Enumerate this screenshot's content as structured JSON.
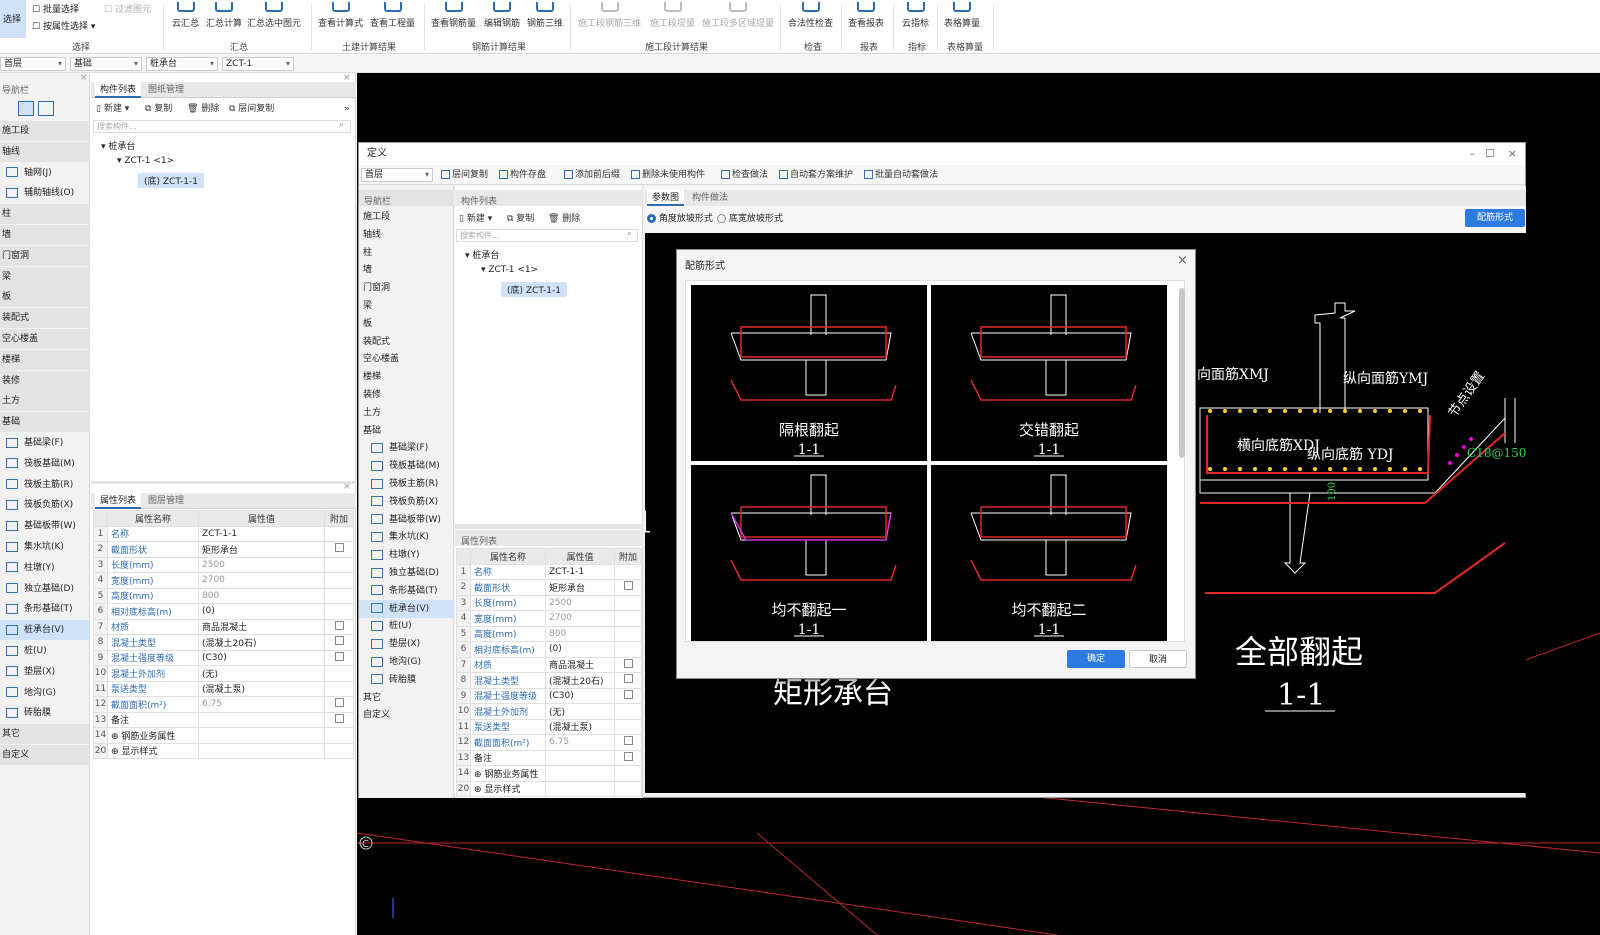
{
  "ribbon": {
    "select": "选择",
    "batch_select": "批量选择",
    "filter_draw": "过滤图元",
    "attr_select": "按属性选择",
    "g_select": "选择",
    "cloud_sum": "云汇总",
    "sum_calc": "汇总计算",
    "sum_sel": "汇总选中图元",
    "g_sum": "汇总",
    "view_formula": "查看计算式",
    "view_qty": "查看工程量",
    "g_civil": "土建计算结果",
    "view_rebar": "查看钢筋量",
    "edit_rebar": "编辑钢筋",
    "rebar_3d": "钢筋三维",
    "g_rebar": "钢筋计算结果",
    "seg_rebar_3d": "施工段钢筋三维",
    "seg_qty": "施工段提量",
    "seg_multi": "施工段多区域提量",
    "g_seg": "施工段计算结果",
    "legal_check": "合法性检查",
    "g_check": "检查",
    "view_report": "查看报表",
    "g_report": "报表",
    "cloud_index": "云指标",
    "g_index": "指标",
    "table_calc": "表格算量",
    "g_table": "表格算量"
  },
  "combos": [
    "首层",
    "基础",
    "桩承台",
    "ZCT-1"
  ],
  "left_nav": {
    "title": "导航栏",
    "items": [
      {
        "label": "施工段",
        "type": "cat"
      },
      {
        "label": "轴线",
        "type": "cat"
      },
      {
        "label": "轴网(J)",
        "icon": "grid-icon"
      },
      {
        "label": "辅助轴线(O)",
        "icon": "aux-axis-icon"
      },
      {
        "label": "柱",
        "type": "cat"
      },
      {
        "label": "墙",
        "type": "cat"
      },
      {
        "label": "门窗洞",
        "type": "cat"
      },
      {
        "label": "梁",
        "type": "cat"
      },
      {
        "label": "板",
        "type": "cat"
      },
      {
        "label": "装配式",
        "type": "cat"
      },
      {
        "label": "空心楼盖",
        "type": "cat"
      },
      {
        "label": "楼梯",
        "type": "cat"
      },
      {
        "label": "装修",
        "type": "cat"
      },
      {
        "label": "土方",
        "type": "cat"
      },
      {
        "label": "基础",
        "type": "cat"
      },
      {
        "label": "基础梁(F)"
      },
      {
        "label": "筏板基础(M)"
      },
      {
        "label": "筏板主筋(R)"
      },
      {
        "label": "筏板负筋(X)"
      },
      {
        "label": "基础板带(W)"
      },
      {
        "label": "集水坑(K)"
      },
      {
        "label": "柱墩(Y)"
      },
      {
        "label": "独立基础(D)"
      },
      {
        "label": "条形基础(T)"
      },
      {
        "label": "桩承台(V)",
        "sel": true
      },
      {
        "label": "桩(U)"
      },
      {
        "label": "垫层(X)"
      },
      {
        "label": "地沟(G)"
      },
      {
        "label": "砖胎膜"
      },
      {
        "label": "其它",
        "type": "cat"
      },
      {
        "label": "自定义",
        "type": "cat"
      }
    ]
  },
  "comp_panel": {
    "tab_list": "构件列表",
    "tab_drawing": "图纸管理",
    "new": "新建",
    "copy": "复制",
    "delete": "删除",
    "floor_copy": "层间复制",
    "search_ph": "搜索构件...",
    "tree_root": "桩承台",
    "tree_child": "ZCT-1 <1>",
    "tree_leaf": "(底) ZCT-1-1"
  },
  "prop_panel": {
    "tab_list": "属性列表",
    "tab_layer": "图层管理",
    "col_name": "属性名称",
    "col_value": "属性值",
    "col_add": "附加",
    "rows": [
      {
        "n": "1",
        "name": "名称",
        "value": "ZCT-1-1",
        "cb": false,
        "blue": true
      },
      {
        "n": "2",
        "name": "截面形状",
        "value": "矩形承台",
        "cb": true,
        "blue": true
      },
      {
        "n": "3",
        "name": "长度(mm)",
        "value": "2500",
        "cb": false,
        "blue": true,
        "gray": true
      },
      {
        "n": "4",
        "name": "宽度(mm)",
        "value": "2700",
        "cb": false,
        "blue": true,
        "gray": true
      },
      {
        "n": "5",
        "name": "高度(mm)",
        "value": "800",
        "cb": false,
        "blue": true,
        "gray": true
      },
      {
        "n": "6",
        "name": "相对底标高(m)",
        "value": "(0)",
        "cb": false,
        "blue": true
      },
      {
        "n": "7",
        "name": "材质",
        "value": "商品混凝土",
        "cb": true,
        "blue": true
      },
      {
        "n": "8",
        "name": "混凝土类型",
        "value": "(混凝土20石)",
        "cb": true,
        "blue": true
      },
      {
        "n": "9",
        "name": "混凝土强度等级",
        "value": "(C30)",
        "cb": true,
        "blue": true
      },
      {
        "n": "10",
        "name": "混凝土外加剂",
        "value": "(无)",
        "cb": false,
        "blue": true
      },
      {
        "n": "11",
        "name": "泵送类型",
        "value": "(混凝土泵)",
        "cb": false,
        "blue": true
      },
      {
        "n": "12",
        "name": "截面面积(m²)",
        "value": "6.75",
        "cb": true,
        "blue": true,
        "gray": true
      },
      {
        "n": "13",
        "name": "备注",
        "value": "",
        "cb": true
      },
      {
        "n": "14",
        "name": "⊕ 钢筋业务属性",
        "value": "",
        "cb": false
      },
      {
        "n": "20",
        "name": "⊕ 显示样式",
        "value": "",
        "cb": false
      }
    ]
  },
  "define_window": {
    "title": "定义",
    "floor": "首层",
    "tools": [
      "层间复制",
      "构件存盘",
      "添加前后缀",
      "删除未使用构件",
      "检查做法",
      "自动套方案维护",
      "批量自动套做法"
    ],
    "nav_title": "导航栏",
    "nav_items": [
      {
        "label": "施工段"
      },
      {
        "label": "轴线"
      },
      {
        "label": "柱"
      },
      {
        "label": "墙"
      },
      {
        "label": "门窗洞"
      },
      {
        "label": "梁"
      },
      {
        "label": "板"
      },
      {
        "label": "装配式"
      },
      {
        "label": "空心楼盖"
      },
      {
        "label": "楼梯"
      },
      {
        "label": "装修"
      },
      {
        "label": "土方"
      },
      {
        "label": "基础"
      },
      {
        "label": "基础梁(F)",
        "sub": true
      },
      {
        "label": "筏板基础(M)",
        "sub": true
      },
      {
        "label": "筏板主筋(R)",
        "sub": true
      },
      {
        "label": "筏板负筋(X)",
        "sub": true
      },
      {
        "label": "基础板带(W)",
        "sub": true
      },
      {
        "label": "集水坑(K)",
        "sub": true
      },
      {
        "label": "柱墩(Y)",
        "sub": true
      },
      {
        "label": "独立基础(D)",
        "sub": true
      },
      {
        "label": "条形基础(T)",
        "sub": true
      },
      {
        "label": "桩承台(V)",
        "sub": true,
        "sel": true
      },
      {
        "label": "桩(U)",
        "sub": true
      },
      {
        "label": "垫层(X)",
        "sub": true
      },
      {
        "label": "地沟(G)",
        "sub": true
      },
      {
        "label": "砖胎膜",
        "sub": true
      },
      {
        "label": "其它"
      },
      {
        "label": "自定义"
      }
    ],
    "comp_title": "构件列表",
    "tab_param": "参数图",
    "tab_method": "构件做法",
    "radio1": "角度放坡形式",
    "radio2": "底宽放坡形式",
    "rebar_form_btn": "配筋形式",
    "prop_title": "属性列表"
  },
  "cad": {
    "main_label": "矩形承台",
    "big_title": "全部翻起",
    "big_sec": "1-1",
    "lbl_xmj": "向面筋XMJ",
    "lbl_ymj": "纵向面筋YMJ",
    "lbl_xdj": "横向底筋XDJ",
    "lbl_ydj": "纵向底筋 YDJ",
    "lbl_c18": "C18@150",
    "lbl_node": "节点设置",
    "lbl_one": "1",
    "lbl_c": "C",
    "lbl_100": "100"
  },
  "dialog": {
    "title": "配筋形式",
    "options": [
      {
        "name": "隔根翻起",
        "sec": "1-1"
      },
      {
        "name": "交错翻起",
        "sec": "1-1"
      },
      {
        "name": "均不翻起一",
        "sec": "1-1"
      },
      {
        "name": "均不翻起二",
        "sec": "1-1"
      }
    ],
    "ok": "确定",
    "cancel": "取消"
  }
}
